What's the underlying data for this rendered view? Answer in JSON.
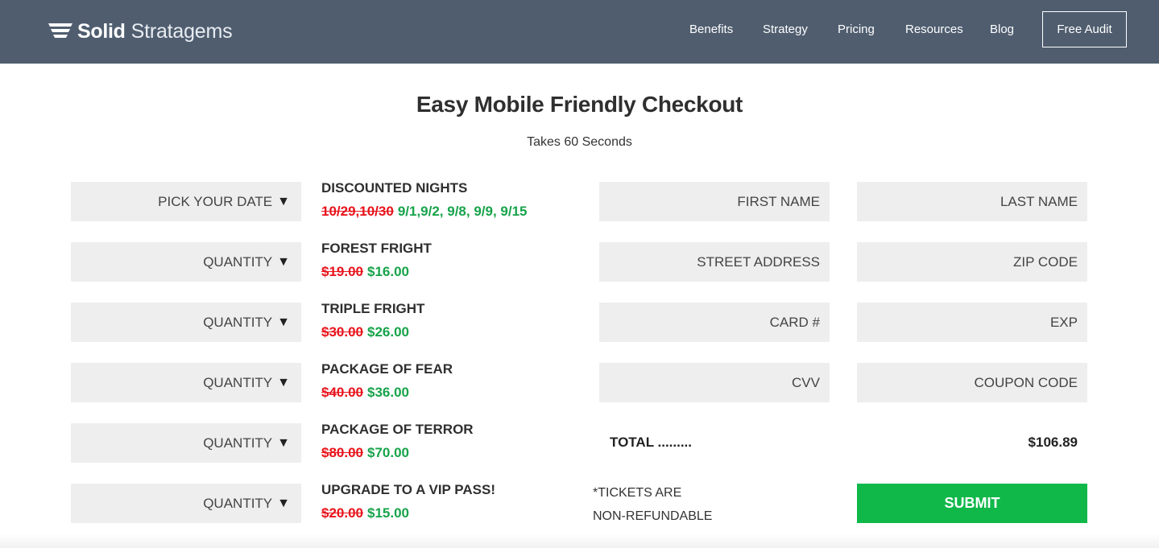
{
  "brand": {
    "bold": "Solid",
    "light": "Stratagems"
  },
  "nav": [
    "Benefits",
    "Strategy",
    "Pricing",
    "Resources",
    "Blog"
  ],
  "cta": "Free Audit",
  "title": "Easy Mobile Friendly Checkout",
  "subtitle": "Takes 60 Seconds",
  "dropdowns": [
    "PICK YOUR DATE",
    "QUANTITY",
    "QUANTITY",
    "QUANTITY",
    "QUANTITY",
    "QUANTITY"
  ],
  "arrow": "▼",
  "products": [
    {
      "name": "DISCOUNTED NIGHTS",
      "old": "10/29,10/30",
      "new": "9/1,9/2, 9/8, 9/9, 9/15"
    },
    {
      "name": "FOREST FRIGHT",
      "old": "$19.00",
      "new": "$16.00"
    },
    {
      "name": "TRIPLE FRIGHT",
      "old": "$30.00",
      "new": "$26.00"
    },
    {
      "name": "PACKAGE OF FEAR",
      "old": "$40.00",
      "new": "$36.00"
    },
    {
      "name": "PACKAGE OF TERROR",
      "old": "$80.00",
      "new": "$70.00"
    },
    {
      "name": "UPGRADE TO A VIP PASS!",
      "old": "$20.00",
      "new": "$15.00"
    }
  ],
  "form": {
    "first_name": "FIRST NAME",
    "last_name": "LAST NAME",
    "street": "STREET ADDRESS",
    "zip": "ZIP CODE",
    "card": "CARD #",
    "exp": "EXP",
    "cvv": "CVV",
    "coupon": "COUPON CODE"
  },
  "total": {
    "label": "TOTAL .........",
    "amount": "$106.89"
  },
  "notice": {
    "line1": "*TICKETS ARE",
    "line2": "NON-REFUNDABLE"
  },
  "submit": "SUBMIT",
  "colors": {
    "header": "#4f5d6f",
    "old_price": "#e8141c",
    "new_price": "#17a34a",
    "submit": "#10b84a",
    "field": "#eeeeee"
  }
}
